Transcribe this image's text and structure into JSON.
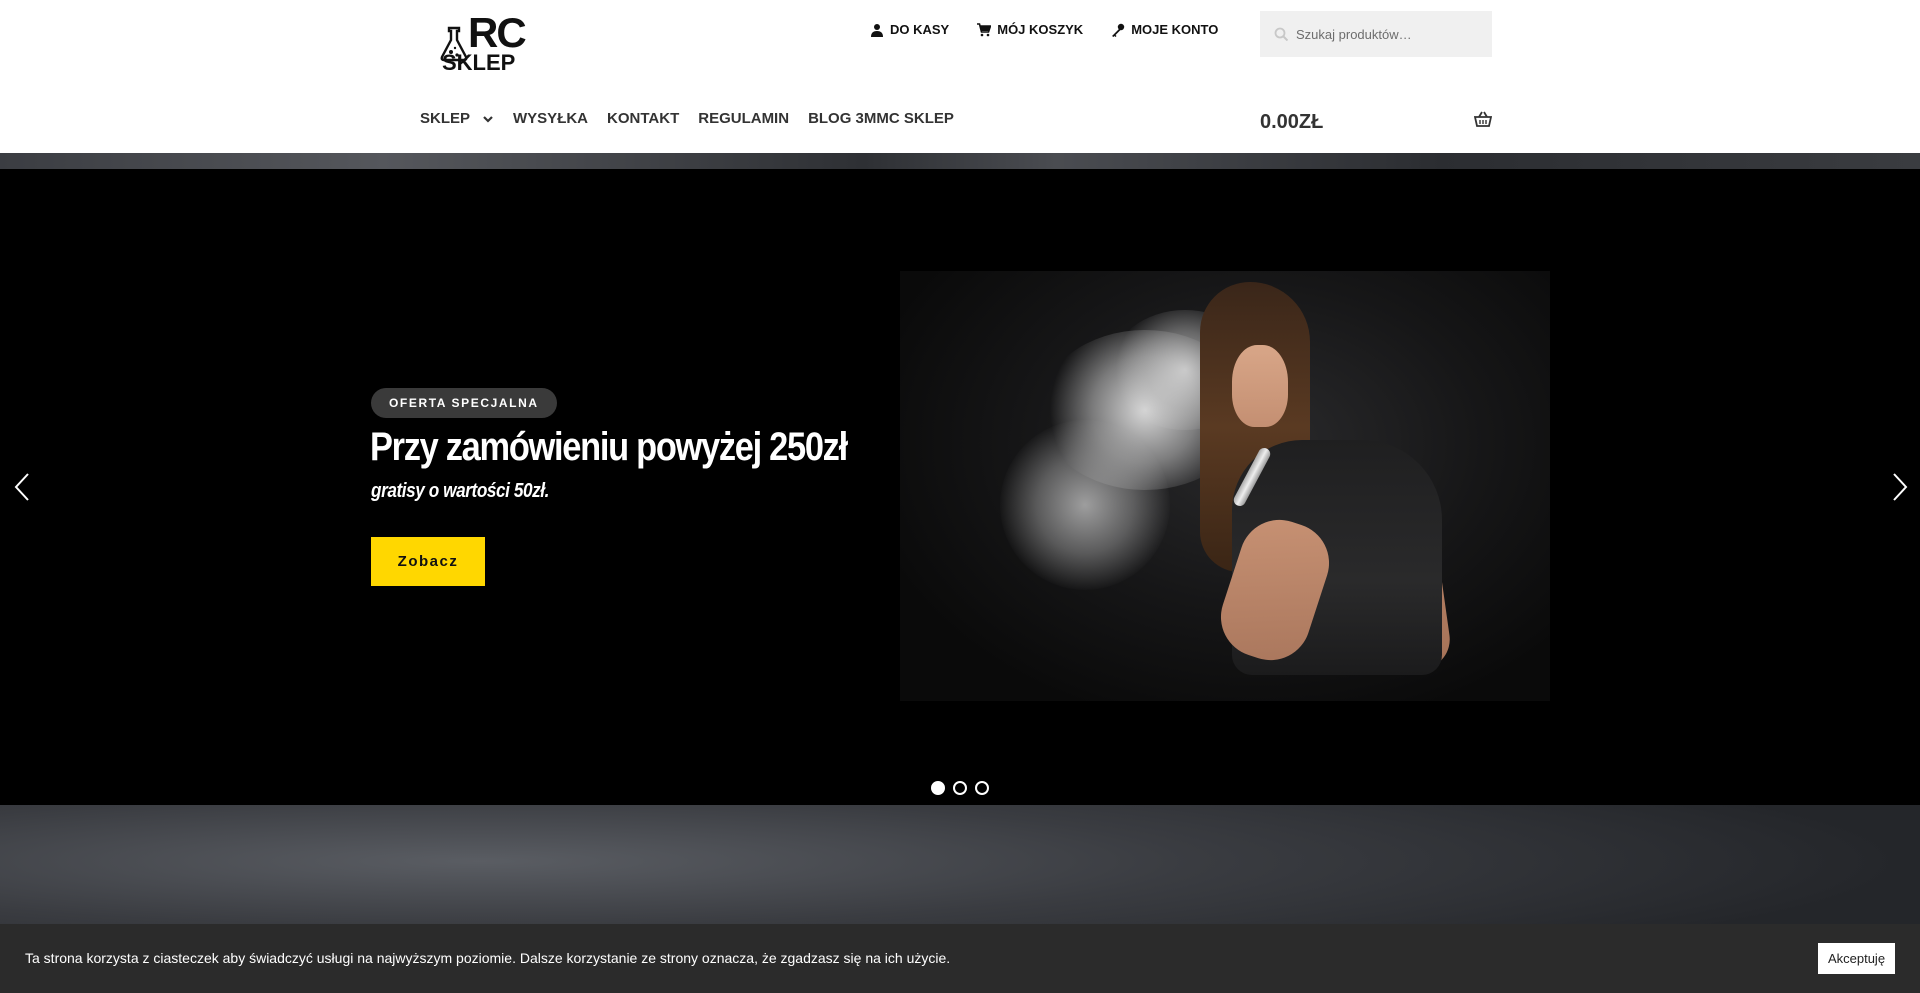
{
  "brand": {
    "logo_top": "RC",
    "logo_bottom": "SKLEP"
  },
  "header": {
    "top_links": [
      {
        "label": "DO KASY",
        "icon": "person-icon"
      },
      {
        "label": "MÓJ KOSZYK",
        "icon": "cart-icon"
      },
      {
        "label": "MOJE KONTO",
        "icon": "key-icon"
      }
    ],
    "search": {
      "placeholder": "Szukaj produktów…",
      "value": ""
    },
    "nav": [
      {
        "label": "SKLEP",
        "has_dropdown": true
      },
      {
        "label": "WYSYŁKA"
      },
      {
        "label": "KONTAKT"
      },
      {
        "label": "REGULAMIN"
      },
      {
        "label": "BLOG 3MMC SKLEP"
      }
    ],
    "cart_total": "0.00ZŁ"
  },
  "hero": {
    "badge": "OFERTA SPECJALNA",
    "title": "Przy zamówieniu powyżej 250zł",
    "subtitle": "gratisy o wartości 50zł.",
    "button_label": "Zobacz",
    "slides_count": 3,
    "active_slide": 1
  },
  "cookie": {
    "text": "Ta strona korzysta z ciasteczek aby świadczyć usługi na najwyższym poziomie. Dalsze korzystanie ze strony oznacza, że zgadzasz się na ich użycie.",
    "accept_label": "Akceptuję"
  },
  "colors": {
    "accent_yellow": "#ffd700",
    "hero_bg": "#000000",
    "cookie_bg": "#2b2b2b",
    "badge_bg": "#3a3a3a"
  }
}
